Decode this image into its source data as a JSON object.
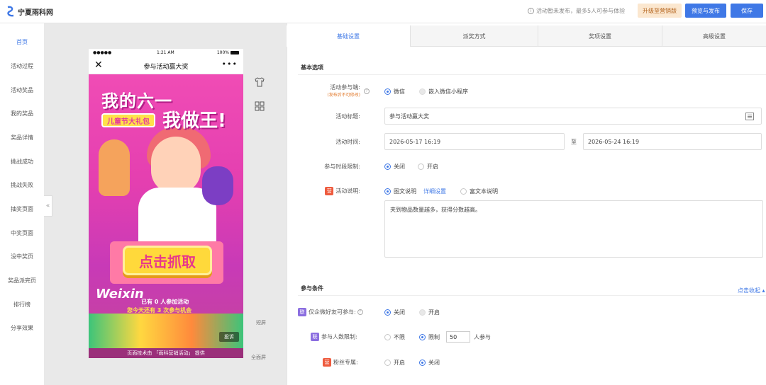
{
  "header": {
    "logo_text": "宁夏雨科网",
    "notice": "活动暂未发布，最多5人可参与体验",
    "upgrade_label": "升级至营销版",
    "preview_publish_label": "预览与发布",
    "save_label": "保存"
  },
  "sidebar": {
    "items": [
      {
        "label": "首页",
        "active": true
      },
      {
        "label": "活动过程"
      },
      {
        "label": "活动奖品"
      },
      {
        "label": "我的奖品"
      },
      {
        "label": "奖品详情"
      },
      {
        "label": "挑战成功"
      },
      {
        "label": "挑战失败"
      },
      {
        "label": "抽奖页面"
      },
      {
        "label": "中奖页面"
      },
      {
        "label": "没中奖页"
      },
      {
        "label": "奖品派完页"
      },
      {
        "label": "排行榜"
      },
      {
        "label": "分享效果"
      }
    ],
    "collapse_glyph": "«"
  },
  "phone": {
    "status_dots": "●●●●●",
    "status_time": "1:21 AM",
    "status_battery": "100%",
    "nav_title": "参与活动赢大奖",
    "poster": {
      "headline_1": "我的六一",
      "headline_2": "我做王!",
      "gift_label": "儿童节大礼包",
      "grab_button": "点击抓取",
      "brand_script": "Weixin",
      "participants_line": "已有 0 人参加活动",
      "chances_line": "您今天还有 3 次参与机会",
      "complain_label": "投诉"
    },
    "footer": "页面技术由 「雨科营销活动」 提供"
  },
  "canvas": {
    "short_screen_label": "短屏",
    "full_screen_label": "全面屏"
  },
  "tabs": [
    {
      "label": "基础设置",
      "active": true
    },
    {
      "label": "派奖方式"
    },
    {
      "label": "奖项设置"
    },
    {
      "label": "高级设置"
    }
  ],
  "basic": {
    "section_title": "基本选项",
    "platform_label": "活动参与端:",
    "platform_sub": "(发布后不可修改)",
    "platform_opt1": "微信",
    "platform_opt2": "嵌入微信小程序",
    "title_label": "活动标题:",
    "title_value": "参与活动赢大奖",
    "time_label": "活动时间:",
    "time_start": "2026-05-17 16:19",
    "time_to": "至",
    "time_end": "2026-05-24 16:19",
    "period_label": "参与时段限制:",
    "period_off": "关闭",
    "period_on": "开启",
    "desc_label": "活动说明:",
    "desc_opt1": "图文说明",
    "desc_detail_link": "详细设置",
    "desc_opt2": "富文本说明",
    "desc_text": "夹到物品数量越多，获得分数越高。"
  },
  "conditions": {
    "section_title": "参与条件",
    "collapse_link": "点击收起 ▴",
    "wecom_label": "仅企微好友可参与:",
    "wecom_off": "关闭",
    "wecom_on": "开启",
    "people_label": "参与人数限制:",
    "people_opt1": "不限",
    "people_opt2": "限制",
    "people_value": "50",
    "people_unit": "人参与",
    "fans_label": "粉丝专属:",
    "fans_on": "开启",
    "fans_off": "关闭",
    "tag_lian": "联",
    "tag_ying": "营"
  }
}
